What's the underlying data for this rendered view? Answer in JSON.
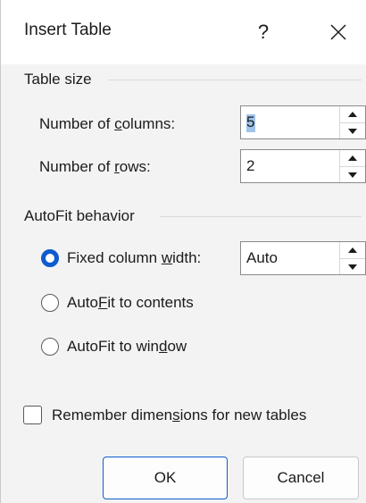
{
  "dialog": {
    "title": "Insert Table",
    "help_label": "?",
    "close_icon": "close-icon"
  },
  "table_size": {
    "group_label": "Table size",
    "columns": {
      "label_pre": "Number of ",
      "label_accel": "c",
      "label_post": "olumns:",
      "value": "5"
    },
    "rows": {
      "label_pre": "Number of ",
      "label_accel": "r",
      "label_post": "ows:",
      "value": "2"
    }
  },
  "autofit": {
    "group_label": "AutoFit behavior",
    "fixed": {
      "label_pre": "Fixed column ",
      "label_accel": "w",
      "label_post": "idth:",
      "value": "Auto",
      "checked": true
    },
    "contents": {
      "label_pre": "Auto",
      "label_accel": "F",
      "label_post": "it to contents",
      "checked": false
    },
    "window": {
      "label_pre": "AutoFit to win",
      "label_accel": "d",
      "label_post": "ow",
      "checked": false
    }
  },
  "remember": {
    "label_pre": "Remember dimen",
    "label_accel": "s",
    "label_post": "ions for new tables",
    "checked": false
  },
  "buttons": {
    "ok_label": "OK",
    "cancel_label": "Cancel"
  },
  "colors": {
    "accent": "#0f5ccf",
    "selection": "#9fc3ea",
    "background": "#f3f3f3",
    "title_bar": "#ffffff"
  }
}
